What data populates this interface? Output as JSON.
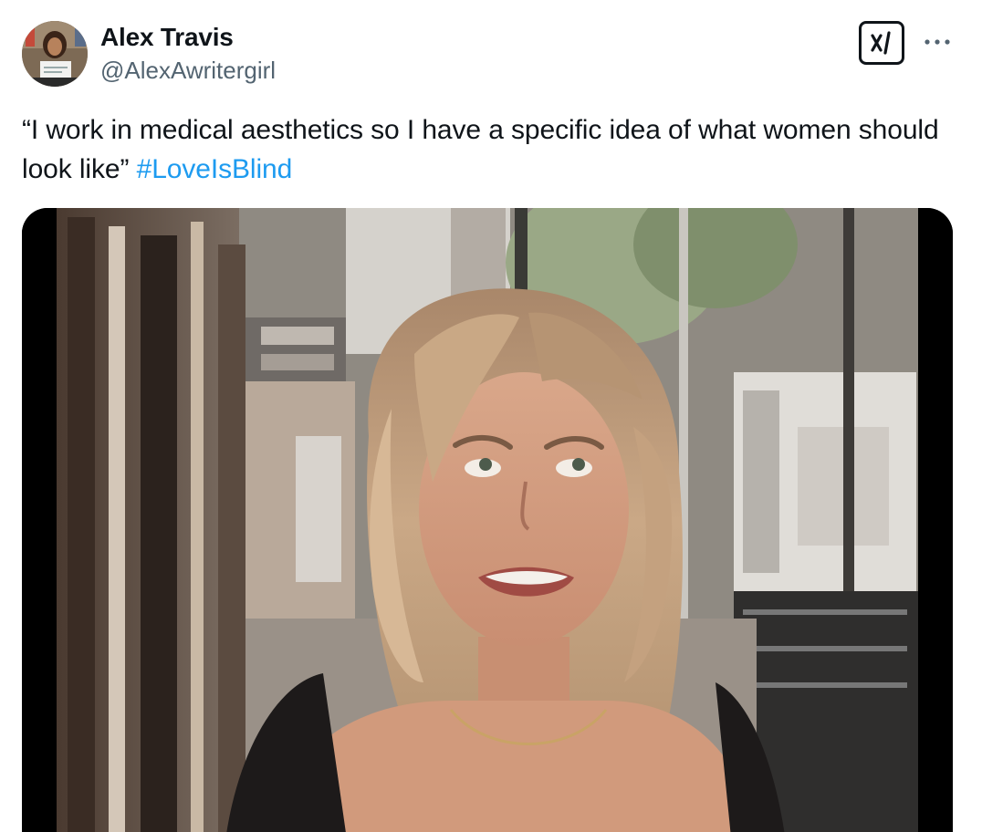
{
  "author": {
    "name": "Alex Travis",
    "handle": "@AlexAwritergirl",
    "avatar_icon": "profile-photo"
  },
  "actions": {
    "grok_icon": "grok-icon",
    "more_icon": "more-horizontal-icon"
  },
  "tweet": {
    "text": "“I work in medical aesthetics so I have a specific idea of what women should look like” ",
    "hashtag": "#LoveIsBlind"
  },
  "media": {
    "type": "video-still",
    "description_icon": "video-frame"
  },
  "colors": {
    "text": "#0f1419",
    "secondary": "#536471",
    "link": "#1d9bf0"
  }
}
